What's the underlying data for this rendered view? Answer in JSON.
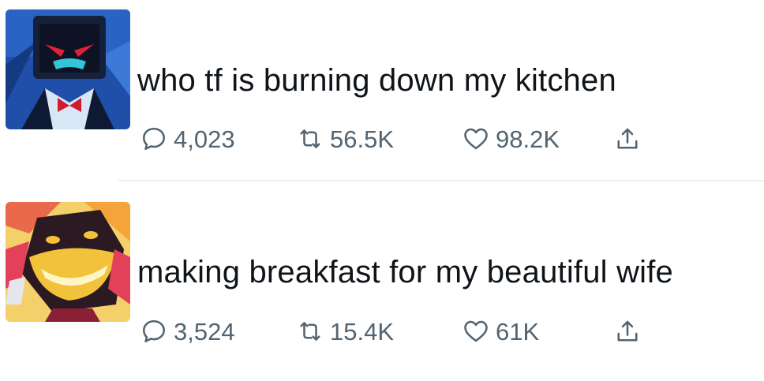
{
  "colors": {
    "text": "#0f1419",
    "secondary": "#536471",
    "divider": "#eceef0"
  },
  "tweets": [
    {
      "avatar": "dark-blue-cartoon-character-with-red-eyes",
      "text": "who tf is burning down my kitchen",
      "replies": "4,023",
      "retweets": "56.5K",
      "likes": "98.2K",
      "icons": [
        "reply-icon",
        "retweet-icon",
        "like-icon",
        "share-icon"
      ]
    },
    {
      "avatar": "grinning-pink-and-yellow-cartoon-character",
      "text": "making breakfast for my beautiful wife",
      "replies": "3,524",
      "retweets": "15.4K",
      "likes": "61K",
      "icons": [
        "reply-icon",
        "retweet-icon",
        "like-icon",
        "share-icon"
      ]
    }
  ]
}
